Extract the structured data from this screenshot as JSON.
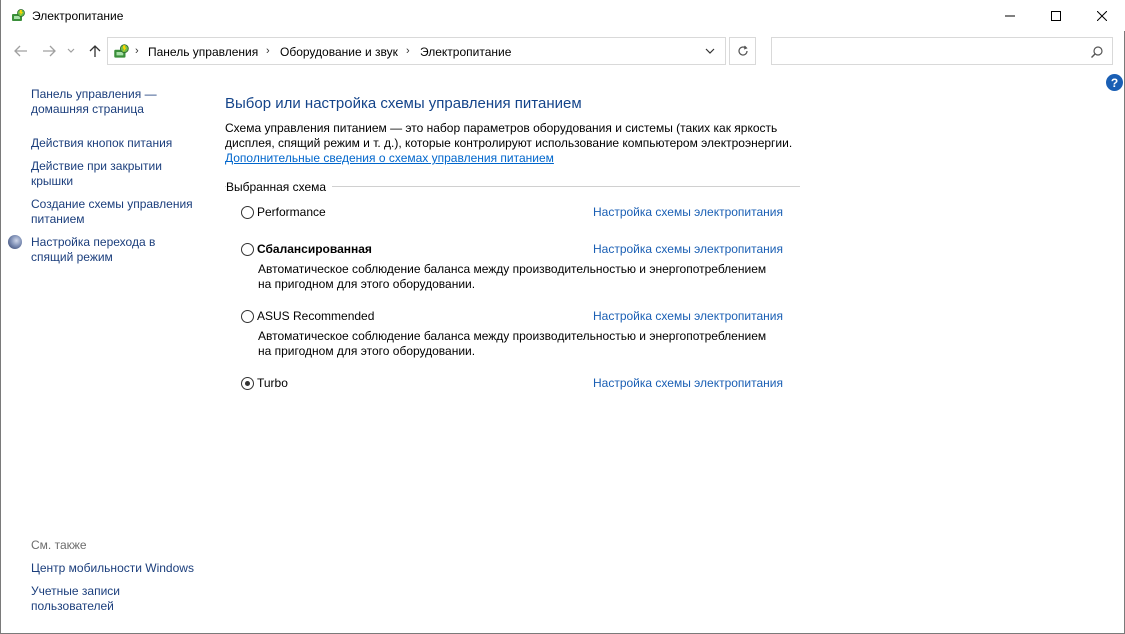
{
  "window": {
    "title": "Электропитание"
  },
  "address": {
    "crumbs": [
      "Панель управления",
      "Оборудование и звук",
      "Электропитание"
    ],
    "search_placeholder": ""
  },
  "sidebar": {
    "home_link": "Панель управления — домашняя страница",
    "home_line1": "Панель управления —",
    "home_line2": "домашняя страница",
    "items": [
      {
        "line1": "Действия кнопок питания",
        "line2": ""
      },
      {
        "line1": "Действие при закрытии",
        "line2": "крышки"
      },
      {
        "line1": "Создание схемы управления",
        "line2": "питанием"
      },
      {
        "line1": "Настройка перехода в",
        "line2": "спящий режим"
      }
    ],
    "see_also_label": "См. также",
    "see_also": [
      {
        "line1": "Центр мобильности Windows",
        "line2": ""
      },
      {
        "line1": "Учетные записи",
        "line2": "пользователей"
      }
    ]
  },
  "main": {
    "title": "Выбор или настройка схемы управления питанием",
    "desc_line1": "Схема управления питанием — это набор параметров оборудования и системы (таких как яркость",
    "desc_line2": "дисплея, спящий режим и т. д.), которые контролируют использование компьютером электроэнергии.",
    "more_link": "Дополнительные сведения о схемах управления питанием",
    "group_label": "Выбранная схема",
    "config_link": "Настройка схемы электропитания",
    "plans": [
      {
        "name": "Performance",
        "selected": false,
        "desc1": "",
        "desc2": ""
      },
      {
        "name": "Сбалансированная",
        "selected": false,
        "desc1": "Автоматическое соблюдение баланса между производительностью и энергопотреблением",
        "desc2": "на пригодном для этого оборудовании."
      },
      {
        "name": "ASUS Recommended",
        "selected": false,
        "desc1": "Автоматическое соблюдение баланса между производительностью и энергопотреблением",
        "desc2": "на пригодном для этого оборудовании."
      },
      {
        "name": "Turbo",
        "selected": true,
        "desc1": "",
        "desc2": ""
      }
    ]
  },
  "icons": {
    "app": "power-options-icon",
    "help": "?",
    "refresh": "↻"
  },
  "colors": {
    "link": "#1a5fb4",
    "title": "#14448a",
    "help": "#1a5fb4"
  }
}
